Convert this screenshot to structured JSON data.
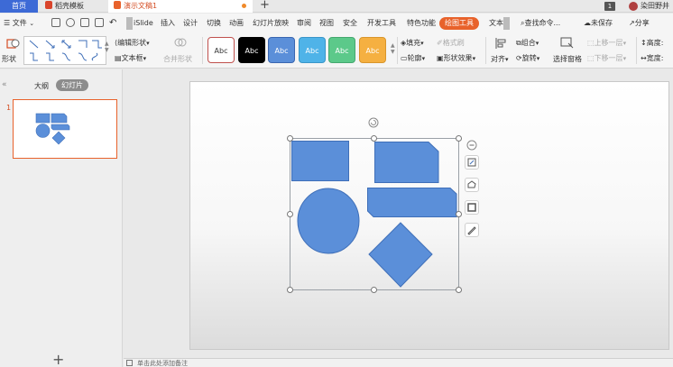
{
  "titlebar": {
    "home_tab": "首页",
    "template_tab": "稻壳模板",
    "document_tab": "演示文稿1",
    "new_tab_symbol": "+",
    "window_badge": "1",
    "user_name": "染田野井"
  },
  "menubar": {
    "file_label": "文件",
    "items": [
      "iSlide",
      "插入",
      "设计",
      "切换",
      "动画",
      "幻灯片放映",
      "审阅",
      "视图",
      "安全",
      "开发工具",
      "特色功能",
      "绘图工具",
      "文本"
    ],
    "active_item": "绘图工具",
    "search_placeholder": "查找命令...",
    "unsaved_label": "未保存",
    "share_label": "分享"
  },
  "ribbon": {
    "shape_label": "形状",
    "edit_shape_label": "编辑形状",
    "textbox_label": "文本框",
    "merge_shape_label": "合并形状",
    "style_sample_text": "Abc",
    "style_buttons": [
      {
        "bg": "#ffffff",
        "fg": "#333333",
        "border": "#c0504d"
      },
      {
        "bg": "#000000",
        "fg": "#ffffff",
        "border": "#000000"
      },
      {
        "bg": "#5b8fd9",
        "fg": "#ffffff",
        "border": "#3a66b0"
      },
      {
        "bg": "#4fb3e8",
        "fg": "#ffffff",
        "border": "#3a96c8"
      },
      {
        "bg": "#5cc98a",
        "fg": "#ffffff",
        "border": "#45a86f"
      },
      {
        "bg": "#f5b041",
        "fg": "#ffffff",
        "border": "#d9962c"
      }
    ],
    "fill_label": "填充",
    "format_brush_label": "格式刷",
    "outline_label": "轮廓",
    "shape_effect_label": "形状效果",
    "align_label": "对齐",
    "group_label": "组合",
    "rotate_label": "旋转",
    "selection_pane_label": "选择窗格",
    "bring_forward_label": "上移一层",
    "send_backward_label": "下移一层",
    "height_label": "高度:",
    "width_label": "宽度:"
  },
  "leftpanel": {
    "outline_tab": "大纲",
    "slides_tab": "幻灯片",
    "slide_number": "1",
    "add_symbol": "+"
  },
  "notes": {
    "placeholder": "单击此处添加备注"
  },
  "colors": {
    "accent": "#e8622b",
    "shape_fill": "#5b8fd9",
    "shape_stroke": "#3f6fb8",
    "home_tab": "#3d6ad6"
  },
  "icons": [
    "new-icon",
    "save-icon",
    "undo-icon",
    "search-icon",
    "share-icon",
    "rotate-handle-icon",
    "minus-icon",
    "layout-icon",
    "edit-shape-icon",
    "fill-icon",
    "pen-icon"
  ]
}
